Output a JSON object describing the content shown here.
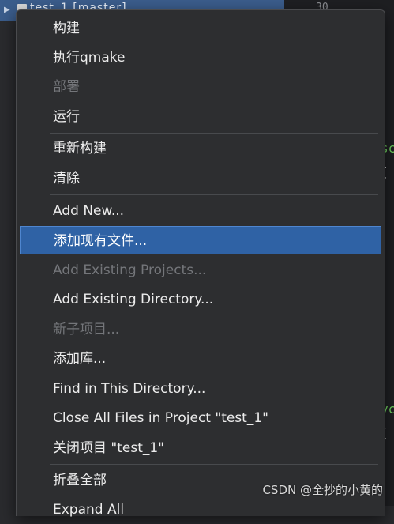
{
  "background": {
    "tree_node": "test_1 [master]",
    "line_number": "30",
    "code_snippets": [
      "sc",
      "[",
      "yc",
      "["
    ]
  },
  "menu": {
    "items": [
      {
        "label": "构建",
        "enabled": true
      },
      {
        "label": "执行qmake",
        "enabled": true
      },
      {
        "label": "部署",
        "enabled": false
      },
      {
        "label": "运行",
        "enabled": true
      },
      {
        "label": "重新构建",
        "enabled": true
      },
      {
        "label": "清除",
        "enabled": true
      },
      {
        "label": "Add New...",
        "enabled": true
      },
      {
        "label": "添加现有文件...",
        "enabled": true,
        "selected": true
      },
      {
        "label": "Add Existing Projects...",
        "enabled": false
      },
      {
        "label": "Add Existing Directory...",
        "enabled": true
      },
      {
        "label": "新子项目...",
        "enabled": false
      },
      {
        "label": "添加库...",
        "enabled": true
      },
      {
        "label": "Find in This Directory...",
        "enabled": true
      },
      {
        "label": "Close All Files in Project \"test_1\"",
        "enabled": true
      },
      {
        "label": "关闭项目 \"test_1\"",
        "enabled": true
      },
      {
        "label": "折叠全部",
        "enabled": true
      },
      {
        "label": "Expand All",
        "enabled": true
      }
    ]
  },
  "watermark": "CSDN @全抄的小黄的",
  "colors": {
    "menu_bg": "#2d2e30",
    "selection": "#2f62a5",
    "disabled_text": "#74767a",
    "code_green": "#6fcf5f"
  }
}
